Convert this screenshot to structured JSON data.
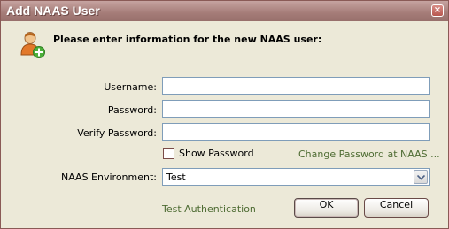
{
  "window": {
    "title": "Add NAAS User",
    "close_glyph": "×"
  },
  "header": {
    "icon": "user-add-icon",
    "text": "Please enter information for the new NAAS user:"
  },
  "form": {
    "username_label": "Username:",
    "username_value": "",
    "password_label": "Password:",
    "password_value": "",
    "verify_label": "Verify Password:",
    "verify_value": "",
    "show_password_label": "Show Password",
    "show_password_checked": false,
    "change_password_link": "Change Password at NAAS ...",
    "environment_label": "NAAS Environment:",
    "environment_value": "Test"
  },
  "footer": {
    "test_auth_link": "Test Authentication",
    "ok_label": "OK",
    "cancel_label": "Cancel"
  },
  "colors": {
    "title_bar": "#a57c78",
    "link": "#4d6b32",
    "dialog_bg": "#ece9d8"
  }
}
